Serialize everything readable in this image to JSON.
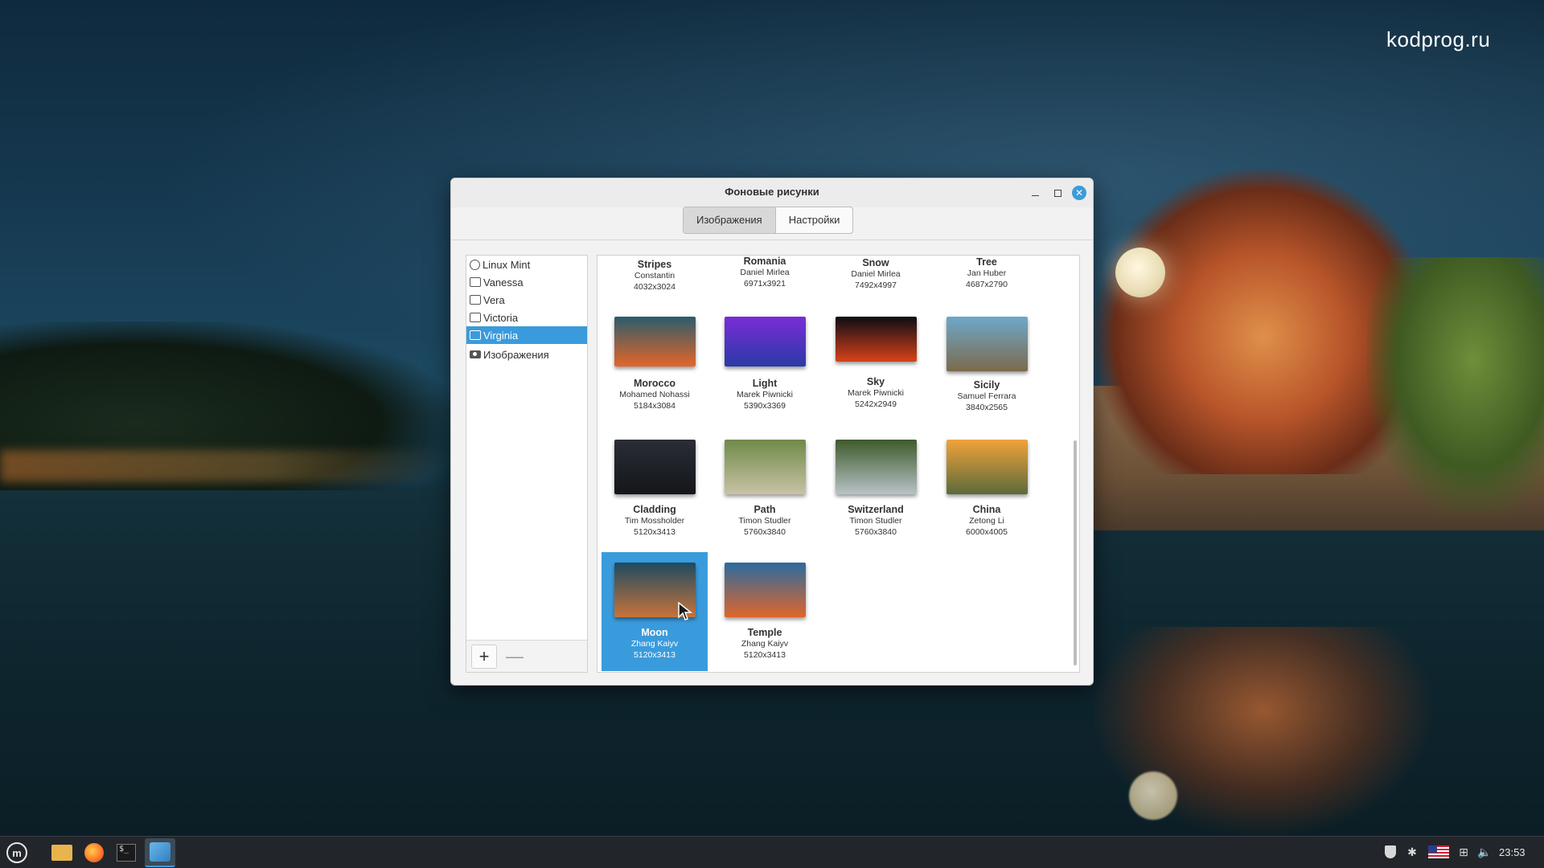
{
  "desktop": {
    "watermark": "kodprog.ru"
  },
  "window": {
    "title": "Фоновые рисунки",
    "tabs": [
      {
        "label": "Изображения",
        "active": true
      },
      {
        "label": "Настройки",
        "active": false
      }
    ],
    "controls": {
      "minimize_icon": "minimize-icon",
      "maximize_icon": "maximize-icon",
      "close_icon": "close-icon"
    }
  },
  "sidebar": {
    "items": [
      {
        "label": "Linux Mint",
        "icon": "linux-mint-logo-icon",
        "selected": false
      },
      {
        "label": "Vanessa",
        "icon": "monitor-icon",
        "selected": false
      },
      {
        "label": "Vera",
        "icon": "monitor-icon",
        "selected": false
      },
      {
        "label": "Victoria",
        "icon": "monitor-icon",
        "selected": false
      },
      {
        "label": "Virginia",
        "icon": "monitor-icon",
        "selected": true
      },
      {
        "label": "Изображения",
        "icon": "camera-icon",
        "selected": false
      }
    ],
    "add_label": "+",
    "remove_label": "—"
  },
  "gallery": {
    "items": [
      {
        "name": "Stripes",
        "author": "Constantin",
        "size": "4032x3024",
        "selected": false,
        "thumb_colors": [
          "#888888",
          "#555555"
        ]
      },
      {
        "name": "Romania",
        "author": "Daniel Mirlea",
        "size": "6971x3921",
        "selected": false,
        "thumb_colors": [
          "#777777",
          "#444444"
        ]
      },
      {
        "name": "Snow",
        "author": "Daniel Mirlea",
        "size": "7492x4997",
        "selected": false,
        "thumb_colors": [
          "#999999",
          "#666666"
        ]
      },
      {
        "name": "Tree",
        "author": "Jan Huber",
        "size": "4687x2790",
        "selected": false,
        "thumb_colors": [
          "#6b7b55",
          "#3f4a33"
        ]
      },
      {
        "name": "Morocco",
        "author": "Mohamed Nohassi",
        "size": "5184x3084",
        "selected": false,
        "thumb_colors": [
          "#2b5c6b",
          "#e5652a"
        ]
      },
      {
        "name": "Light",
        "author": "Marek Piwnicki",
        "size": "5390x3369",
        "selected": false,
        "thumb_colors": [
          "#7a2cd6",
          "#2a3aa8"
        ]
      },
      {
        "name": "Sky",
        "author": "Marek Piwnicki",
        "size": "5242x2949",
        "selected": false,
        "thumb_colors": [
          "#0c0c14",
          "#d9421a"
        ]
      },
      {
        "name": "Sicily",
        "author": "Samuel Ferrara",
        "size": "3840x2565",
        "selected": false,
        "thumb_colors": [
          "#6ea8c9",
          "#7b6a4c"
        ]
      },
      {
        "name": "Cladding",
        "author": "Tim Mossholder",
        "size": "5120x3413",
        "selected": false,
        "thumb_colors": [
          "#2a2d36",
          "#14161b"
        ]
      },
      {
        "name": "Path",
        "author": "Timon Studler",
        "size": "5760x3840",
        "selected": false,
        "thumb_colors": [
          "#6f8a4a",
          "#c9c2a4"
        ]
      },
      {
        "name": "Switzerland",
        "author": "Timon Studler",
        "size": "5760x3840",
        "selected": false,
        "thumb_colors": [
          "#3e5a2c",
          "#b8c2c6"
        ]
      },
      {
        "name": "China",
        "author": "Zetong Li",
        "size": "6000x4005",
        "selected": false,
        "thumb_colors": [
          "#f0a33a",
          "#5c6a3a"
        ]
      },
      {
        "name": "Moon",
        "author": "Zhang Kaiyv",
        "size": "5120x3413",
        "selected": true,
        "thumb_colors": [
          "#1d4a62",
          "#c8733a"
        ]
      },
      {
        "name": "Temple",
        "author": "Zhang Kaiyv",
        "size": "5120x3413",
        "selected": false,
        "thumb_colors": [
          "#2a6aa0",
          "#e0662a"
        ]
      }
    ]
  },
  "taskbar": {
    "launchers": [
      {
        "name": "menu-button",
        "icon": "linux-mint-logo-icon"
      },
      {
        "name": "files-launcher",
        "icon": "folder-icon"
      },
      {
        "name": "firefox-launcher",
        "icon": "firefox-icon"
      },
      {
        "name": "terminal-launcher",
        "icon": "terminal-icon"
      },
      {
        "name": "backgrounds-task",
        "icon": "wallpaper-icon"
      }
    ],
    "tray": [
      "shield-icon",
      "bluetooth-icon",
      "us-flag-keyboard-icon",
      "network-icon",
      "volume-icon"
    ],
    "clock": "23:53"
  },
  "colors": {
    "accent": "#3a9bdc",
    "window_bg": "#f2f2f2",
    "taskbar_bg": "#22262b"
  }
}
